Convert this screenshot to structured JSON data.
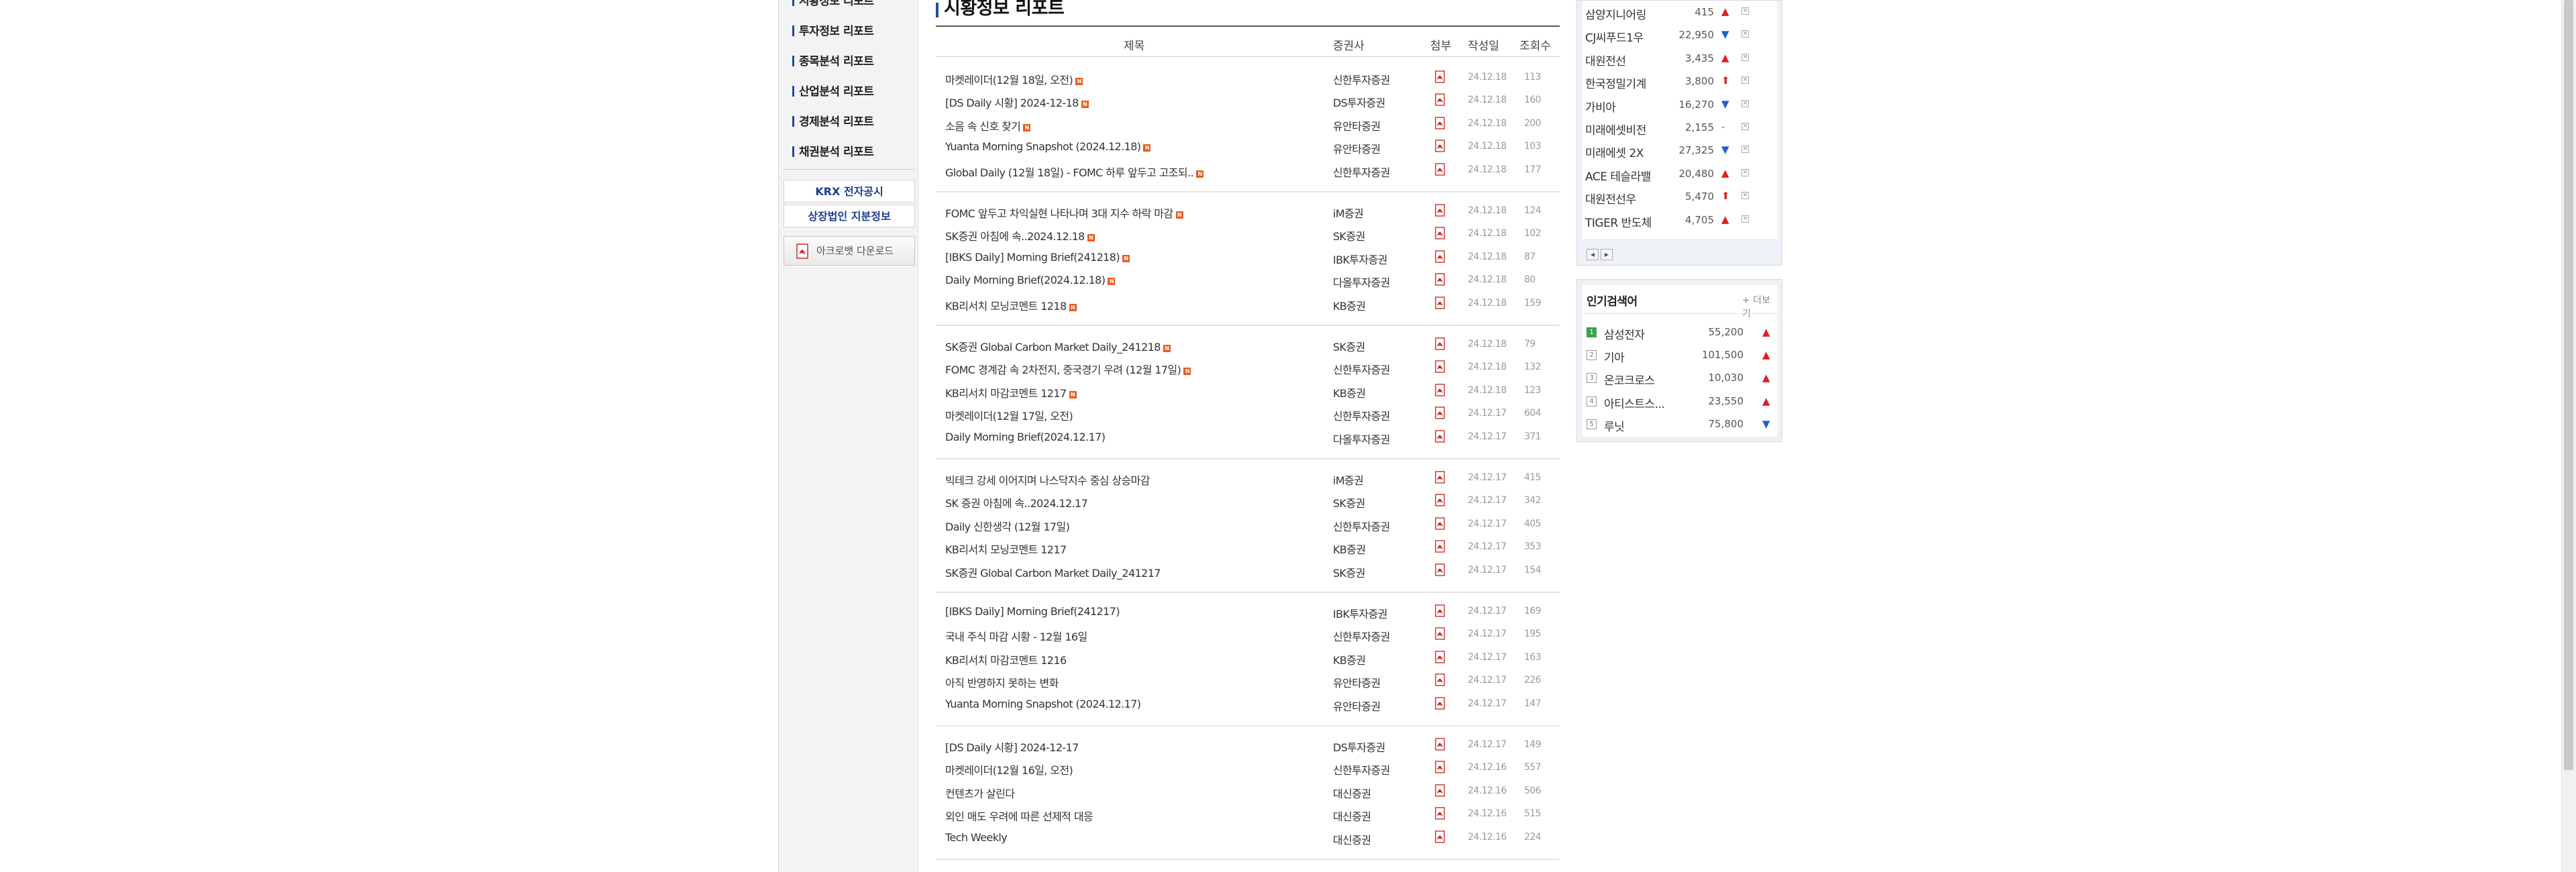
{
  "left_nav": {
    "items": [
      {
        "label": "시황정보 리포트"
      },
      {
        "label": "투자정보 리포트"
      },
      {
        "label": "종목분석 리포트"
      },
      {
        "label": "산업분석 리포트"
      },
      {
        "label": "경제분석 리포트"
      },
      {
        "label": "채권분석 리포트"
      }
    ],
    "links": [
      {
        "label": "KRX 전자공시"
      },
      {
        "label": "상장법인 지분정보"
      }
    ],
    "acrobat_label": "아크로뱃 다운로드"
  },
  "main": {
    "title": "시황정보 리포트",
    "headers": {
      "title": "제목",
      "broker": "증권사",
      "attachment": "첨부",
      "date": "작성일",
      "views": "조회수"
    },
    "rows": [
      {
        "title": "마켓레이더(12월 18일, 오전)",
        "new": true,
        "broker": "신한투자증권",
        "date": "24.12.18",
        "views": "113"
      },
      {
        "title": "[DS Daily 시황] 2024-12-18",
        "new": true,
        "broker": "DS투자증권",
        "date": "24.12.18",
        "views": "160"
      },
      {
        "title": "소음 속 신호 찾기",
        "new": true,
        "broker": "유안타증권",
        "date": "24.12.18",
        "views": "200"
      },
      {
        "title": "Yuanta Morning Snapshot (2024.12.18)",
        "new": true,
        "broker": "유안타증권",
        "date": "24.12.18",
        "views": "103"
      },
      {
        "title": "Global Daily (12월 18일) - FOMC 하루 앞두고 고조되..",
        "new": true,
        "broker": "신한투자증권",
        "date": "24.12.18",
        "views": "177"
      },
      {
        "title": "FOMC 앞두고 차익실현 나타나며 3대 지수 하락 마감",
        "new": true,
        "broker": "iM증권",
        "date": "24.12.18",
        "views": "124"
      },
      {
        "title": "SK증권 아침에 속..2024.12.18",
        "new": true,
        "broker": "SK증권",
        "date": "24.12.18",
        "views": "102"
      },
      {
        "title": "[IBKS Daily] Morning Brief(241218)",
        "new": true,
        "broker": "IBK투자증권",
        "date": "24.12.18",
        "views": "87"
      },
      {
        "title": "Daily Morning Brief(2024.12.18)",
        "new": true,
        "broker": "다올투자증권",
        "date": "24.12.18",
        "views": "80"
      },
      {
        "title": "KB리서치 모닝코멘트 1218",
        "new": true,
        "broker": "KB증권",
        "date": "24.12.18",
        "views": "159"
      },
      {
        "title": "SK증권 Global Carbon Market Daily_241218",
        "new": true,
        "broker": "SK증권",
        "date": "24.12.18",
        "views": "79"
      },
      {
        "title": "FOMC 경계감 속 2차전지, 중국경기 우려 (12월 17일)",
        "new": true,
        "broker": "신한투자증권",
        "date": "24.12.18",
        "views": "132"
      },
      {
        "title": "KB리서치 마감코멘트 1217",
        "new": true,
        "broker": "KB증권",
        "date": "24.12.18",
        "views": "123"
      },
      {
        "title": "마켓레이더(12월 17일, 오전)",
        "new": false,
        "broker": "신한투자증권",
        "date": "24.12.17",
        "views": "604"
      },
      {
        "title": "Daily Morning Brief(2024.12.17)",
        "new": false,
        "broker": "다올투자증권",
        "date": "24.12.17",
        "views": "371"
      },
      {
        "title": "빅테크 강세 이어지며 나스닥지수 중심 상승마감",
        "new": false,
        "broker": "iM증권",
        "date": "24.12.17",
        "views": "415"
      },
      {
        "title": "SK 증권 아침에 속..2024.12.17",
        "new": false,
        "broker": "SK증권",
        "date": "24.12.17",
        "views": "342"
      },
      {
        "title": "Daily 신한생각 (12월 17일)",
        "new": false,
        "broker": "신한투자증권",
        "date": "24.12.17",
        "views": "405"
      },
      {
        "title": "KB리서치 모닝코멘트 1217",
        "new": false,
        "broker": "KB증권",
        "date": "24.12.17",
        "views": "353"
      },
      {
        "title": "SK증권 Global Carbon Market Daily_241217",
        "new": false,
        "broker": "SK증권",
        "date": "24.12.17",
        "views": "154"
      },
      {
        "title": "[IBKS Daily] Morning Brief(241217)",
        "new": false,
        "broker": "IBK투자증권",
        "date": "24.12.17",
        "views": "169"
      },
      {
        "title": "국내 주식 마감 시황 - 12월 16일",
        "new": false,
        "broker": "신한투자증권",
        "date": "24.12.17",
        "views": "195"
      },
      {
        "title": "KB리서치 마감코멘트 1216",
        "new": false,
        "broker": "KB증권",
        "date": "24.12.17",
        "views": "163"
      },
      {
        "title": "아직 반영하지 못하는 변화",
        "new": false,
        "broker": "유안타증권",
        "date": "24.12.17",
        "views": "226"
      },
      {
        "title": "Yuanta Morning Snapshot (2024.12.17)",
        "new": false,
        "broker": "유안타증권",
        "date": "24.12.17",
        "views": "147"
      },
      {
        "title": "[DS Daily 시황] 2024-12-17",
        "new": false,
        "broker": "DS투자증권",
        "date": "24.12.17",
        "views": "149"
      },
      {
        "title": "마켓레이더(12월 16일, 오전)",
        "new": false,
        "broker": "신한투자증권",
        "date": "24.12.16",
        "views": "557"
      },
      {
        "title": "컨텐츠가 살린다",
        "new": false,
        "broker": "대신증권",
        "date": "24.12.16",
        "views": "506"
      },
      {
        "title": "외인 매도 우려에 따른 선제적 대응",
        "new": false,
        "broker": "대신증권",
        "date": "24.12.16",
        "views": "515"
      },
      {
        "title": "Tech Weekly",
        "new": false,
        "broker": "대신증권",
        "date": "24.12.16",
        "views": "224"
      }
    ]
  },
  "stock_list": {
    "rows": [
      {
        "name": "삼양지니어링",
        "price": "415",
        "dir": "up"
      },
      {
        "name": "CJ씨푸드1우",
        "price": "22,950",
        "dir": "down"
      },
      {
        "name": "대원전선",
        "price": "3,435",
        "dir": "up"
      },
      {
        "name": "한국정밀기계",
        "price": "3,800",
        "dir": "upper"
      },
      {
        "name": "가비아",
        "price": "16,270",
        "dir": "down"
      },
      {
        "name": "미래에셋비전",
        "price": "2,155",
        "dir": "flat"
      },
      {
        "name": "미래에셋 2X",
        "price": "27,325",
        "dir": "down"
      },
      {
        "name": "ACE 테슬라밸",
        "price": "20,480",
        "dir": "up"
      },
      {
        "name": "대원전선우",
        "price": "5,470",
        "dir": "upper"
      },
      {
        "name": "TIGER 반도체",
        "price": "4,705",
        "dir": "up"
      }
    ]
  },
  "popular": {
    "title": "인기검색어",
    "more": "+ 더보기",
    "rows": [
      {
        "rank": "1",
        "name": "삼성전자",
        "price": "55,200",
        "dir": "up"
      },
      {
        "rank": "2",
        "name": "기아",
        "price": "101,500",
        "dir": "up"
      },
      {
        "rank": "3",
        "name": "온코크로스",
        "price": "10,030",
        "dir": "up"
      },
      {
        "rank": "4",
        "name": "아티스트스...",
        "price": "23,550",
        "dir": "up"
      },
      {
        "rank": "5",
        "name": "루닛",
        "price": "75,800",
        "dir": "down"
      }
    ]
  },
  "glyphs": {
    "up": "▲",
    "down": "▼",
    "flat": "-",
    "upper": "⬆",
    "remove": "×",
    "prev": "◀",
    "next": "▶",
    "new": "N"
  }
}
